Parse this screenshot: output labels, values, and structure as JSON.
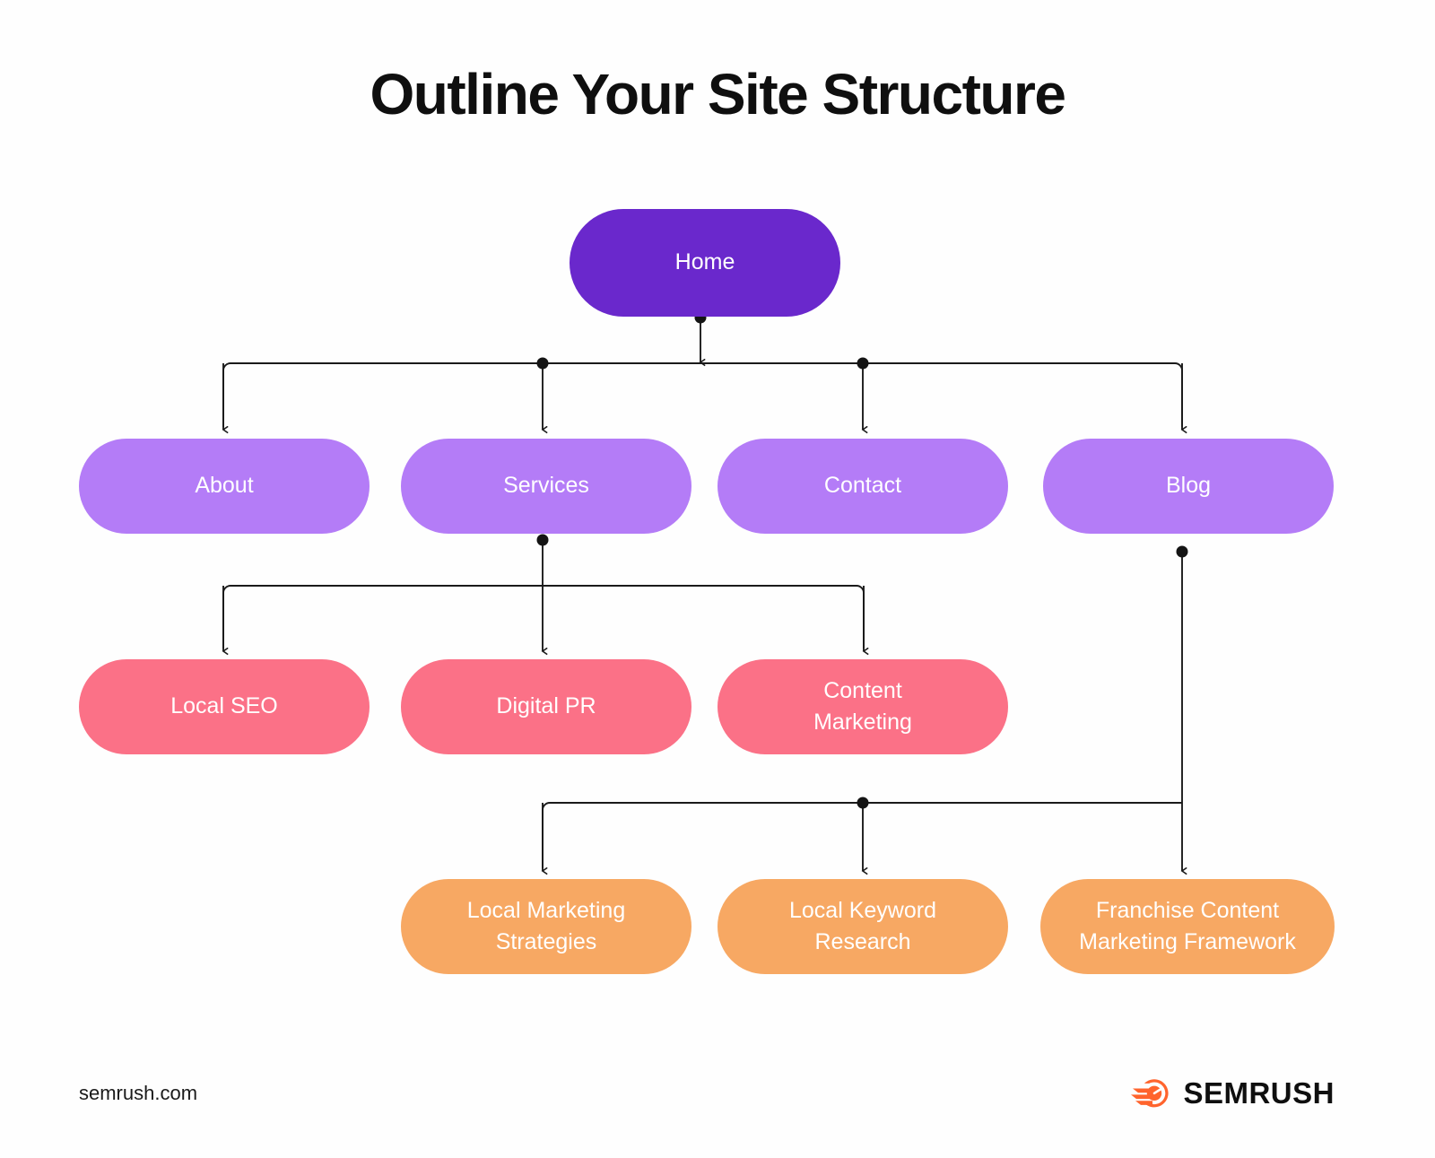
{
  "title": "Outline Your Site Structure",
  "footer": {
    "url": "semrush.com",
    "logo_text": "SEMRUSH",
    "logo_icon": "semrush-comet-icon",
    "logo_color": "#FF642D"
  },
  "colors": {
    "background": "#FEFEFE",
    "level0": "#6A28CC",
    "level1": "#B47CF7",
    "level2": "#FB7187",
    "level3": "#F7A863",
    "connector": "#1a1a1a",
    "node_text": "#FFFFFF",
    "title_text": "#0F0F0F"
  },
  "chart_data": {
    "type": "diagram",
    "diagram_kind": "site-structure-tree",
    "title": "Outline Your Site Structure",
    "levels": [
      {
        "index": 0,
        "color": "#6A28CC",
        "labels": [
          "Home"
        ]
      },
      {
        "index": 1,
        "color": "#B47CF7",
        "labels": [
          "About",
          "Services",
          "Contact",
          "Blog"
        ]
      },
      {
        "index": 2,
        "color": "#FB7187",
        "labels": [
          "Local SEO",
          "Digital PR",
          "Content Marketing"
        ]
      },
      {
        "index": 3,
        "color": "#F7A863",
        "labels": [
          "Local Marketing Strategies",
          "Local Keyword Research",
          "Franchise Content Marketing Framework"
        ]
      }
    ],
    "edges": [
      {
        "from": "Home",
        "to": "About"
      },
      {
        "from": "Home",
        "to": "Services"
      },
      {
        "from": "Home",
        "to": "Contact"
      },
      {
        "from": "Home",
        "to": "Blog"
      },
      {
        "from": "Services",
        "to": "Local SEO"
      },
      {
        "from": "Services",
        "to": "Digital PR"
      },
      {
        "from": "Services",
        "to": "Content Marketing"
      },
      {
        "from": "Blog",
        "to": "Local Marketing Strategies"
      },
      {
        "from": "Blog",
        "to": "Local Keyword Research"
      },
      {
        "from": "Blog",
        "to": "Franchise Content Marketing Framework"
      }
    ]
  },
  "nodes": {
    "home": {
      "label": "Home"
    },
    "about": {
      "label": "About"
    },
    "services": {
      "label": "Services"
    },
    "contact": {
      "label": "Contact"
    },
    "blog": {
      "label": "Blog"
    },
    "local_seo": {
      "label": "Local SEO"
    },
    "digital_pr": {
      "label": "Digital PR"
    },
    "content_marketing": {
      "label": "Content\nMarketing"
    },
    "local_marketing_strategies": {
      "label": "Local Marketing\nStrategies"
    },
    "local_keyword_research": {
      "label": "Local Keyword\nResearch"
    },
    "franchise_content": {
      "label": "Franchise Content\nMarketing Framework"
    }
  }
}
